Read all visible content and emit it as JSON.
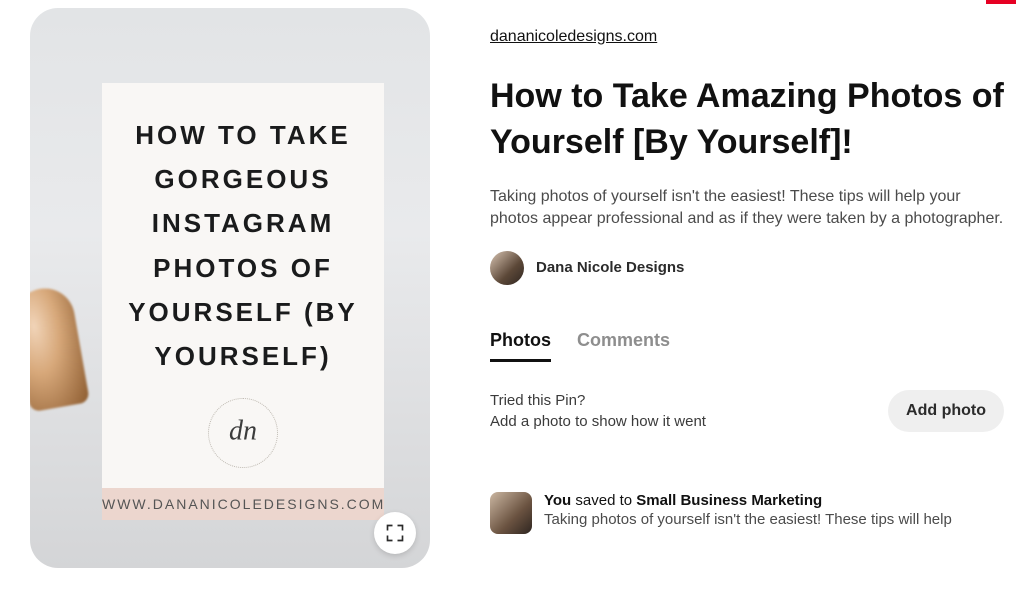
{
  "source_domain": "dananicoledesigns.com",
  "pin_media": {
    "card_title": "HOW TO TAKE GORGEOUS INSTAGRAM PHOTOS OF YOURSELF (BY YOURSELF)",
    "logo_text": "dn",
    "footer_url": "WWW.DANANICOLEDESIGNS.COM"
  },
  "pin_title": "How to Take Amazing Photos of Yourself [By Yourself]!",
  "pin_description": "Taking photos of yourself isn't the easiest! These tips will help your photos appear professional and as if they were taken by a photographer.",
  "author": {
    "name": "Dana Nicole Designs"
  },
  "tabs": {
    "photos": "Photos",
    "comments": "Comments"
  },
  "tried": {
    "line1": "Tried this Pin?",
    "line2": "Add a photo to show how it went",
    "button": "Add photo"
  },
  "saved": {
    "you": "You",
    "mid": " saved to ",
    "board": "Small Business Marketing",
    "desc": "Taking photos of yourself isn't the easiest! These tips will help"
  }
}
